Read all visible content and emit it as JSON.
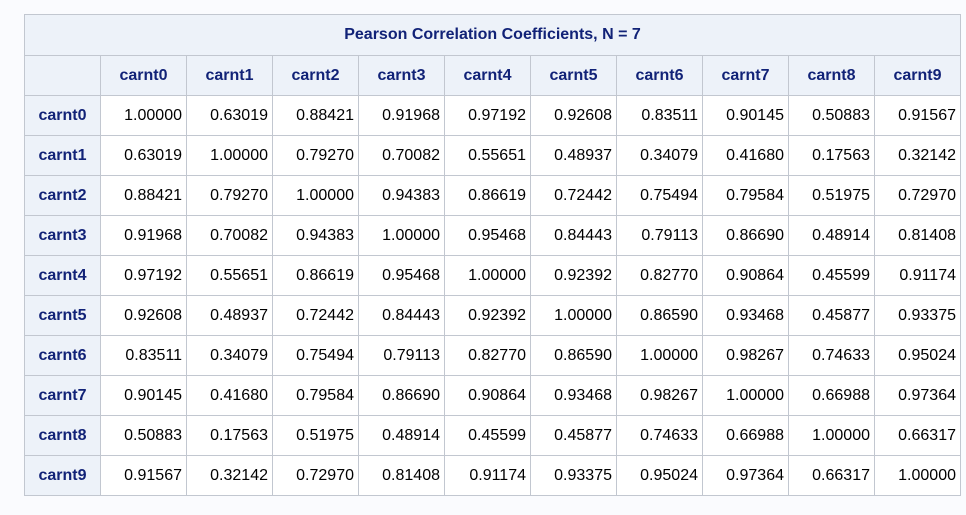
{
  "table": {
    "caption": "Pearson Correlation Coefficients, N = 7",
    "columns": [
      "carnt0",
      "carnt1",
      "carnt2",
      "carnt3",
      "carnt4",
      "carnt5",
      "carnt6",
      "carnt7",
      "carnt8",
      "carnt9"
    ],
    "rows": [
      {
        "label": "carnt0",
        "values": [
          "1.00000",
          "0.63019",
          "0.88421",
          "0.91968",
          "0.97192",
          "0.92608",
          "0.83511",
          "0.90145",
          "0.50883",
          "0.91567"
        ]
      },
      {
        "label": "carnt1",
        "values": [
          "0.63019",
          "1.00000",
          "0.79270",
          "0.70082",
          "0.55651",
          "0.48937",
          "0.34079",
          "0.41680",
          "0.17563",
          "0.32142"
        ]
      },
      {
        "label": "carnt2",
        "values": [
          "0.88421",
          "0.79270",
          "1.00000",
          "0.94383",
          "0.86619",
          "0.72442",
          "0.75494",
          "0.79584",
          "0.51975",
          "0.72970"
        ]
      },
      {
        "label": "carnt3",
        "values": [
          "0.91968",
          "0.70082",
          "0.94383",
          "1.00000",
          "0.95468",
          "0.84443",
          "0.79113",
          "0.86690",
          "0.48914",
          "0.81408"
        ]
      },
      {
        "label": "carnt4",
        "values": [
          "0.97192",
          "0.55651",
          "0.86619",
          "0.95468",
          "1.00000",
          "0.92392",
          "0.82770",
          "0.90864",
          "0.45599",
          "0.91174"
        ]
      },
      {
        "label": "carnt5",
        "values": [
          "0.92608",
          "0.48937",
          "0.72442",
          "0.84443",
          "0.92392",
          "1.00000",
          "0.86590",
          "0.93468",
          "0.45877",
          "0.93375"
        ]
      },
      {
        "label": "carnt6",
        "values": [
          "0.83511",
          "0.34079",
          "0.75494",
          "0.79113",
          "0.82770",
          "0.86590",
          "1.00000",
          "0.98267",
          "0.74633",
          "0.95024"
        ]
      },
      {
        "label": "carnt7",
        "values": [
          "0.90145",
          "0.41680",
          "0.79584",
          "0.86690",
          "0.90864",
          "0.93468",
          "0.98267",
          "1.00000",
          "0.66988",
          "0.97364"
        ]
      },
      {
        "label": "carnt8",
        "values": [
          "0.50883",
          "0.17563",
          "0.51975",
          "0.48914",
          "0.45599",
          "0.45877",
          "0.74633",
          "0.66988",
          "1.00000",
          "0.66317"
        ]
      },
      {
        "label": "carnt9",
        "values": [
          "0.91567",
          "0.32142",
          "0.72970",
          "0.81408",
          "0.91174",
          "0.93375",
          "0.95024",
          "0.97364",
          "0.66317",
          "1.00000"
        ]
      }
    ]
  },
  "colors": {
    "header_background": "#edf2f9",
    "header_text": "#112277",
    "border": "#c2c7d0",
    "cell_background": "#ffffff"
  }
}
